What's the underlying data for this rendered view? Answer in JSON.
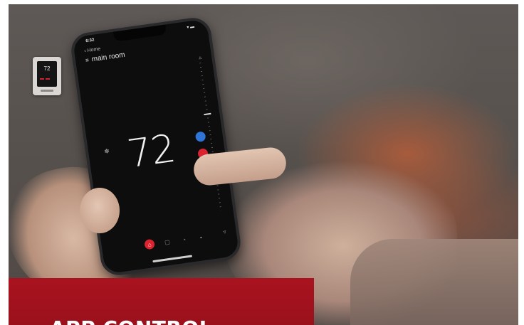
{
  "phone": {
    "status_time": "6:32",
    "status_icons": "▾ ▬",
    "back_label": "Home",
    "room_name": "main room",
    "temperature": "72",
    "up_arrow": "▵",
    "down_arrow": "▿"
  },
  "wall_thermostat": {
    "display": "72"
  },
  "promo": {
    "title": "APP CONTROL"
  },
  "colors": {
    "accent_red": "#d9232e",
    "cool_blue": "#2f74d8",
    "promo_red": "#a9131f"
  },
  "icons": [
    "back-chevron-icon",
    "menu-icon",
    "mode-icon",
    "home-icon",
    "schedule-icon",
    "settings-icon",
    "devices-icon"
  ]
}
